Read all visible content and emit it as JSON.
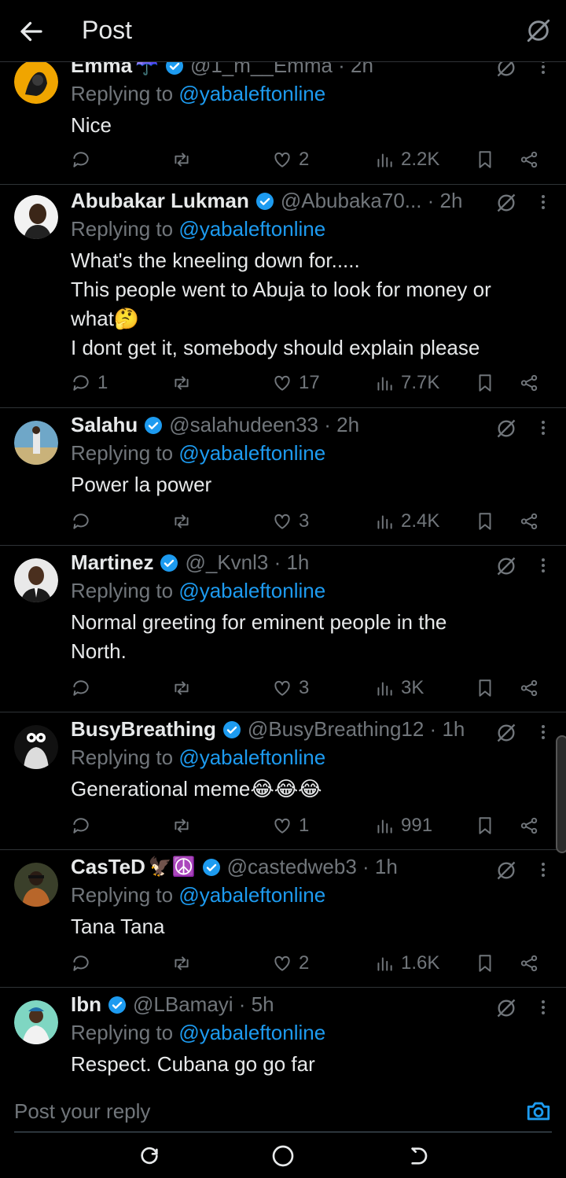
{
  "header": {
    "title": "Post",
    "back_icon": "arrow-left-icon",
    "grok_icon": "grok-icon"
  },
  "colors": {
    "background": "#000000",
    "text": "#e7e9ea",
    "muted": "#71767b",
    "accent": "#1d9bf0",
    "divider": "#2f3336"
  },
  "replies": [
    {
      "name": "Emma",
      "emoji": "☂️",
      "handle": "@1_m__Emma · 2h",
      "replying_prefix": "Replying to",
      "replying_handle": "@yabaleftonline",
      "lines": [
        "Nice"
      ],
      "comments": "",
      "likes": "2",
      "views": "2.2K"
    },
    {
      "name": "Abubakar Lukman",
      "emoji": "",
      "handle": "@Abubaka70... · 2h",
      "replying_prefix": "Replying to",
      "replying_handle": "@yabaleftonline",
      "lines": [
        "What's the kneeling down for.....",
        "This people went to Abuja to look for money or",
        "what🤔",
        "I dont get it, somebody should explain please"
      ],
      "comments": "1",
      "likes": "17",
      "views": "7.7K"
    },
    {
      "name": "Salahu",
      "emoji": "",
      "handle": "@salahudeen33 · 2h",
      "replying_prefix": "Replying to",
      "replying_handle": "@yabaleftonline",
      "lines": [
        "Power la power"
      ],
      "comments": "",
      "likes": "3",
      "views": "2.4K"
    },
    {
      "name": "Martinez",
      "emoji": "",
      "handle": "@_Kvnl3 · 1h",
      "replying_prefix": "Replying to",
      "replying_handle": "@yabaleftonline",
      "lines": [
        "Normal greeting for eminent people in the",
        "North."
      ],
      "comments": "",
      "likes": "3",
      "views": "3K"
    },
    {
      "name": "BusyBreathing",
      "emoji": "",
      "handle": "@BusyBreathing12 · 1h",
      "replying_prefix": "Replying to",
      "replying_handle": "@yabaleftonline",
      "lines": [
        "Generational meme😂😂😂"
      ],
      "comments": "",
      "likes": "1",
      "views": "991"
    },
    {
      "name": "CasTeD",
      "emoji": "🦅☮️",
      "handle": "@castedweb3 · 1h",
      "replying_prefix": "Replying to",
      "replying_handle": "@yabaleftonline",
      "lines": [
        "Tana Tana"
      ],
      "comments": "",
      "likes": "2",
      "views": "1.6K"
    },
    {
      "name": "Ibn",
      "emoji": "",
      "handle": "@LBamayi · 5h",
      "replying_prefix": "Replying to",
      "replying_handle": "@yabaleftonline",
      "lines": [
        "Respect. Cubana go go far"
      ],
      "comments": "",
      "likes": "",
      "views": ""
    }
  ],
  "compose": {
    "placeholder": "Post your reply",
    "camera_icon": "camera-icon"
  },
  "navbar": {
    "recents_icon": "recents-icon",
    "home_icon": "home-circle-icon",
    "back_icon": "nav-back-icon"
  }
}
